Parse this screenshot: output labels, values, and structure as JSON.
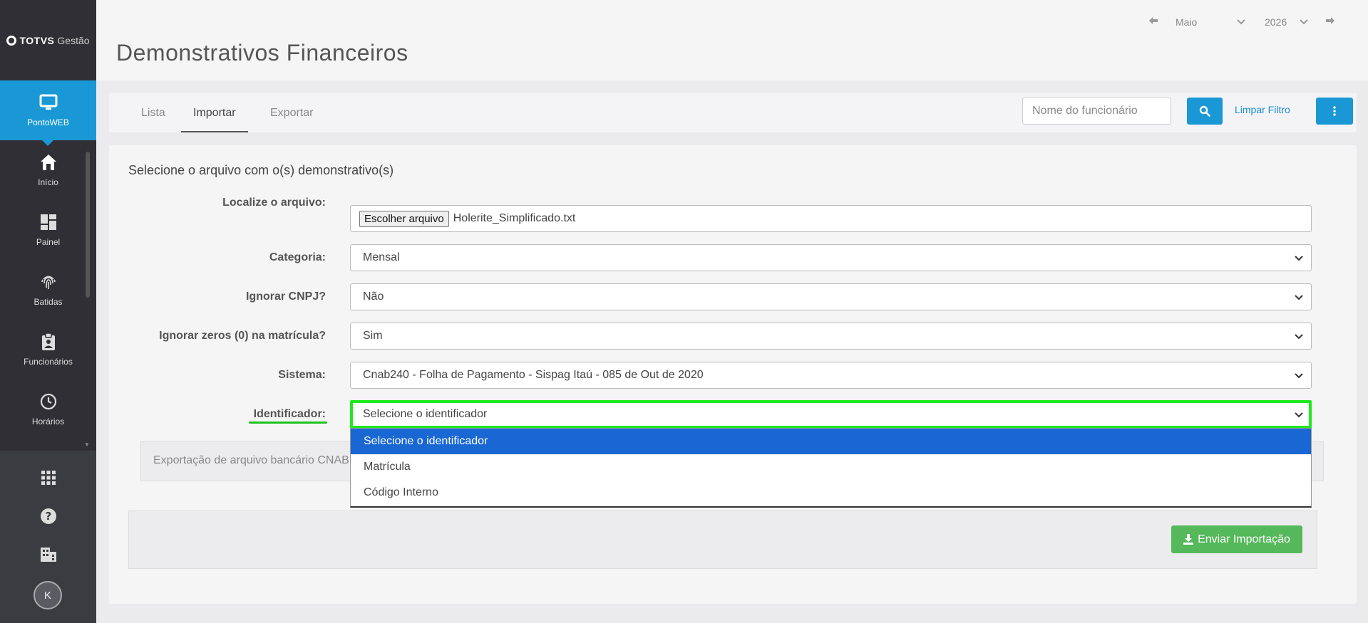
{
  "brand": {
    "logo_bold": "TOTVS",
    "logo_light": "Gestão"
  },
  "sidebar": {
    "items": [
      {
        "label": "PontoWEB",
        "icon": "monitor-icon",
        "active": true
      },
      {
        "label": "Início",
        "icon": "home-icon"
      },
      {
        "label": "Painel",
        "icon": "dashboard-icon"
      },
      {
        "label": "Batidas",
        "icon": "fingerprint-icon"
      },
      {
        "label": "Funcionários",
        "icon": "badge-icon"
      },
      {
        "label": "Horários",
        "icon": "clock-icon"
      }
    ],
    "avatar_initial": "K"
  },
  "header": {
    "title": "Demonstrativos Financeiros",
    "month": "Maio",
    "year": "2026"
  },
  "tabs": [
    {
      "label": "Lista"
    },
    {
      "label": "Importar",
      "active": true
    },
    {
      "label": "Exportar"
    }
  ],
  "search": {
    "placeholder": "Nome do funcionário",
    "clear_label": "Limpar Filtro"
  },
  "form": {
    "title": "Selecione o arquivo com o(s) demonstrativo(s)",
    "file_label": "Localize o arquivo:",
    "file_button": "Escolher arquivo",
    "file_name": "Holerite_Simplificado.txt",
    "categoria_label": "Categoria:",
    "categoria_value": "Mensal",
    "cnpj_label": "Ignorar CNPJ?",
    "cnpj_value": "Não",
    "zeros_label": "Ignorar zeros (0) na matrícula?",
    "zeros_value": "Sim",
    "sistema_label": "Sistema:",
    "sistema_value": "Cnab240 - Folha de Pagamento - Sispag Itaú - 085 de Out de 2020",
    "identificador_label": "Identificador:",
    "identificador_value": "Selecione o identificador",
    "identificador_options": [
      "Selecione o identificador",
      "Matrícula",
      "Código Interno"
    ],
    "info_text": "Exportação de arquivo bancário CNAB"
  },
  "actions": {
    "send_label": "Enviar Importação"
  },
  "colors": {
    "primary": "#1a98d5",
    "success": "#55b85a",
    "sidebar": "#2f2f35",
    "focus": "#1ee81e"
  }
}
